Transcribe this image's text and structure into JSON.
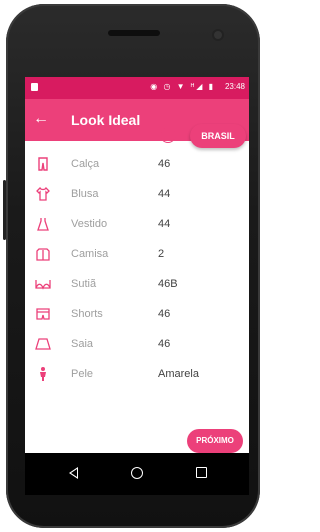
{
  "status": {
    "time": "23:48",
    "icons": "◉ ◷ ▼ ᴴ◢ ▮"
  },
  "appbar": {
    "back_icon": "←",
    "title": "Look Ideal"
  },
  "actions": {
    "info_icon": "i",
    "country_label": "BRASIL",
    "next_label": "PRÓXIMO"
  },
  "rows": [
    {
      "label": "Calça",
      "value": "46",
      "icon": "pants-icon"
    },
    {
      "label": "Blusa",
      "value": "44",
      "icon": "shirt-icon"
    },
    {
      "label": "Vestido",
      "value": "44",
      "icon": "dress-icon"
    },
    {
      "label": "Camisa",
      "value": "2",
      "icon": "buttoned-shirt-icon"
    },
    {
      "label": "Sutiã",
      "value": "46B",
      "icon": "bra-icon"
    },
    {
      "label": "Shorts",
      "value": "46",
      "icon": "shorts-icon"
    },
    {
      "label": "Saia",
      "value": "46",
      "icon": "skirt-icon"
    },
    {
      "label": "Pele",
      "value": "Amarela",
      "icon": "person-icon"
    }
  ],
  "colors": {
    "primary": "#ec407a",
    "status": "#d81b60"
  }
}
